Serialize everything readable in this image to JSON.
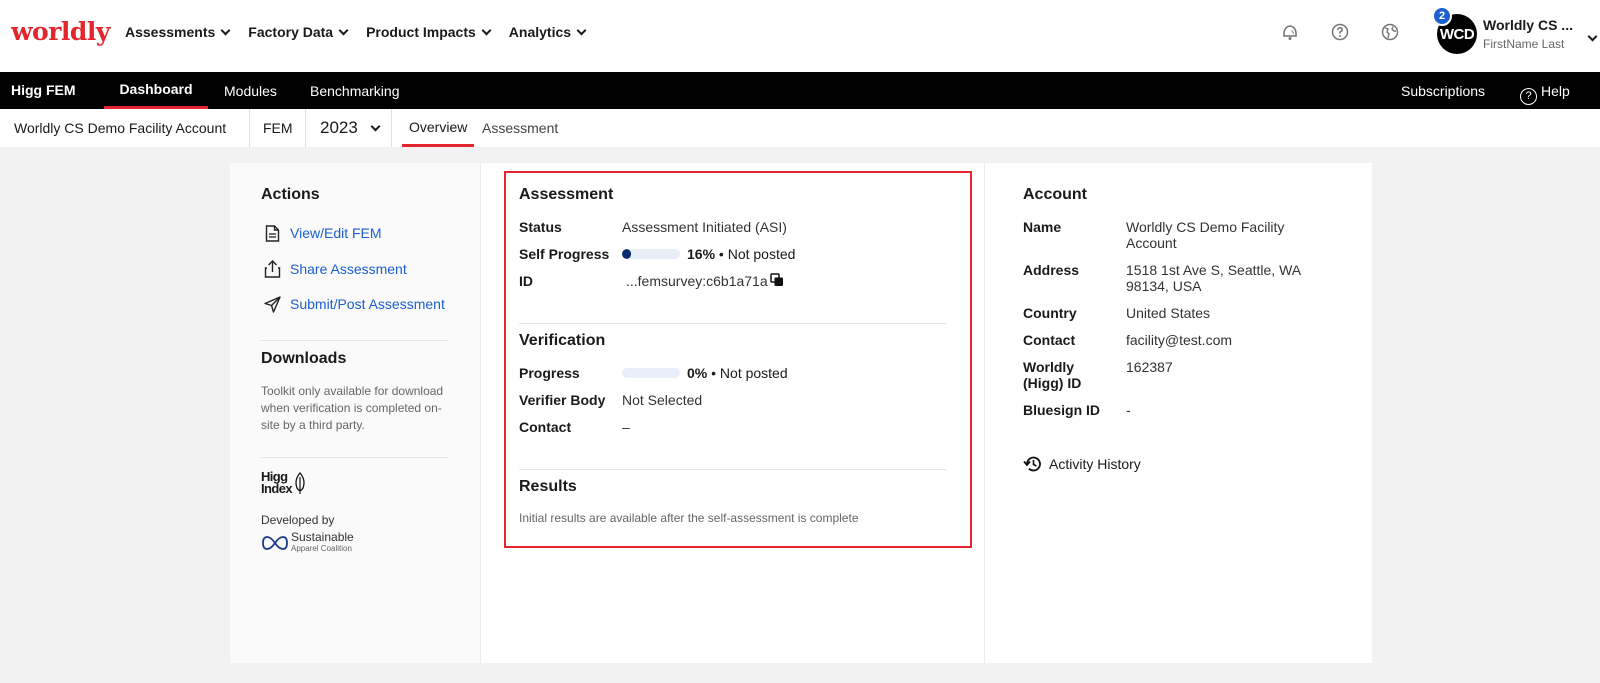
{
  "brand": {
    "logo": "worldly",
    "accent": "#e3262d",
    "link": "#1b5fd1"
  },
  "topnav": {
    "menu": [
      "Assessments",
      "Factory Data",
      "Product Impacts",
      "Analytics"
    ],
    "icons": [
      "notification-bell-icon",
      "help-circle-icon",
      "globe-icon"
    ],
    "user": {
      "initials": "WCD",
      "badge": "2",
      "name": "Worldly CS ...",
      "sub": "FirstName Last"
    }
  },
  "blackbar": {
    "title": "Higg FEM",
    "tabs": [
      "Dashboard",
      "Modules",
      "Benchmarking"
    ],
    "active_tab": "Dashboard",
    "right": {
      "subscriptions": "Subscriptions",
      "help": "Help"
    }
  },
  "subbar": {
    "account": "Worldly CS Demo Facility Account",
    "module": "FEM",
    "year": "2023",
    "tabs": [
      "Overview",
      "Assessment"
    ],
    "active_tab": "Overview"
  },
  "actions": {
    "title": "Actions",
    "items": [
      "View/Edit FEM",
      "Share Assessment",
      "Submit/Post Assessment"
    ]
  },
  "downloads": {
    "title": "Downloads",
    "note": "Toolkit only available for download when verification is completed on-site by a third party.",
    "higg_logo": "Higg Index",
    "developed_by": "Developed by",
    "partner": "Sustainable",
    "partner_sub": "Apparel Coalition"
  },
  "assessment": {
    "title": "Assessment",
    "status_label": "Status",
    "status": "Assessment Initiated (ASI)",
    "progress_label": "Self Progress",
    "progress": 16,
    "progress_pct": "16%",
    "progress_state": "• Not posted",
    "id_label": "ID",
    "id": "...femsurvey:c6b1a71a"
  },
  "verification": {
    "title": "Verification",
    "progress_label": "Progress",
    "progress": 0,
    "progress_pct": "0%",
    "progress_state": "• Not posted",
    "body_label": "Verifier Body",
    "body": "Not Selected",
    "contact_label": "Contact",
    "contact": "–"
  },
  "results": {
    "title": "Results",
    "note": "Initial results are available after the self-assessment is complete"
  },
  "account": {
    "title": "Account",
    "name_label": "Name",
    "name": "Worldly CS Demo Facility Account",
    "address_label": "Address",
    "address": "1518 1st Ave S, Seattle, WA 98134, USA",
    "country_label": "Country",
    "country": "United States",
    "contact_label": "Contact",
    "contact": "facility@test.com",
    "worldly_id_label": "Worldly (Higg) ID",
    "worldly_id": "162387",
    "bluesign_label": "Bluesign ID",
    "bluesign": "-",
    "activity": "Activity History"
  }
}
